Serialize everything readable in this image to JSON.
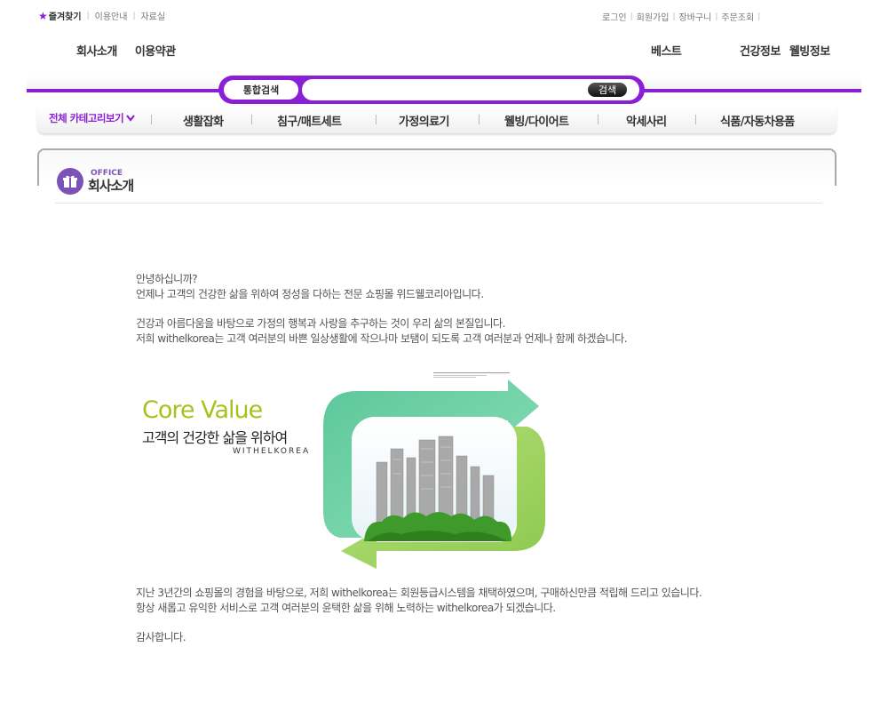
{
  "util": {
    "bookmark": "즐겨찾기",
    "guide": "이용안내",
    "resources": "자료실",
    "login": "로그인",
    "join": "회원가입",
    "cart": "장바구니",
    "order": "주문조회"
  },
  "nav": {
    "company": "회사소개",
    "terms": "이용약관",
    "best": "베스트",
    "health": "건강정보",
    "wellbeing": "웰빙정보"
  },
  "search": {
    "label": "통합검색",
    "button": "검색",
    "value": ""
  },
  "categories": {
    "all": "전체 카테고리보기",
    "items": [
      "생활잡화",
      "침구/매트세트",
      "가정의료기",
      "웰빙/다이어트",
      "악세사리",
      "식품/자동차용품"
    ]
  },
  "page": {
    "eng_title": "OFFICE",
    "title": "회사소개"
  },
  "intro": {
    "p1_l1": "안녕하십니까?",
    "p1_l2": "언제나 고객의 건강한 삶을 위하여 정성을 다하는 전문 쇼핑몰 위드웰코리아입니다.",
    "p2_l1": "건강과 아름다움을 바탕으로 가정의 행복과 사랑을 추구하는 것이 우리 삶의 본질입니다.",
    "p2_l2": "저희 withelkorea는 고객 여러분의 바쁜 일상생활에 작으나마 보탬이 되도록 고객 여러분과 언제나 함께 하겠습니다.",
    "p3_l1": "지난 3년간의 쇼핑몰의 경험을 바탕으로, 저희 withelkorea는 회원등급시스템을 채택하였으며, 구매하신만큼 적립해 드리고 있습니다.",
    "p3_l2": "항상 새롭고 유익한 서비스로 고객 여러분의 윤택한 삶을 위해 노력하는 withelkorea가 되겠습니다.",
    "p4_l1": "감사합니다."
  },
  "core_value": {
    "title": "Core Value",
    "subtitle": "고객의 건강한 삶을 위하여",
    "brand": "WITHELKOREA"
  },
  "colors": {
    "accent": "#8a1fd6",
    "core_green": "#a6c21f",
    "office_icon": "#7b52b8"
  }
}
